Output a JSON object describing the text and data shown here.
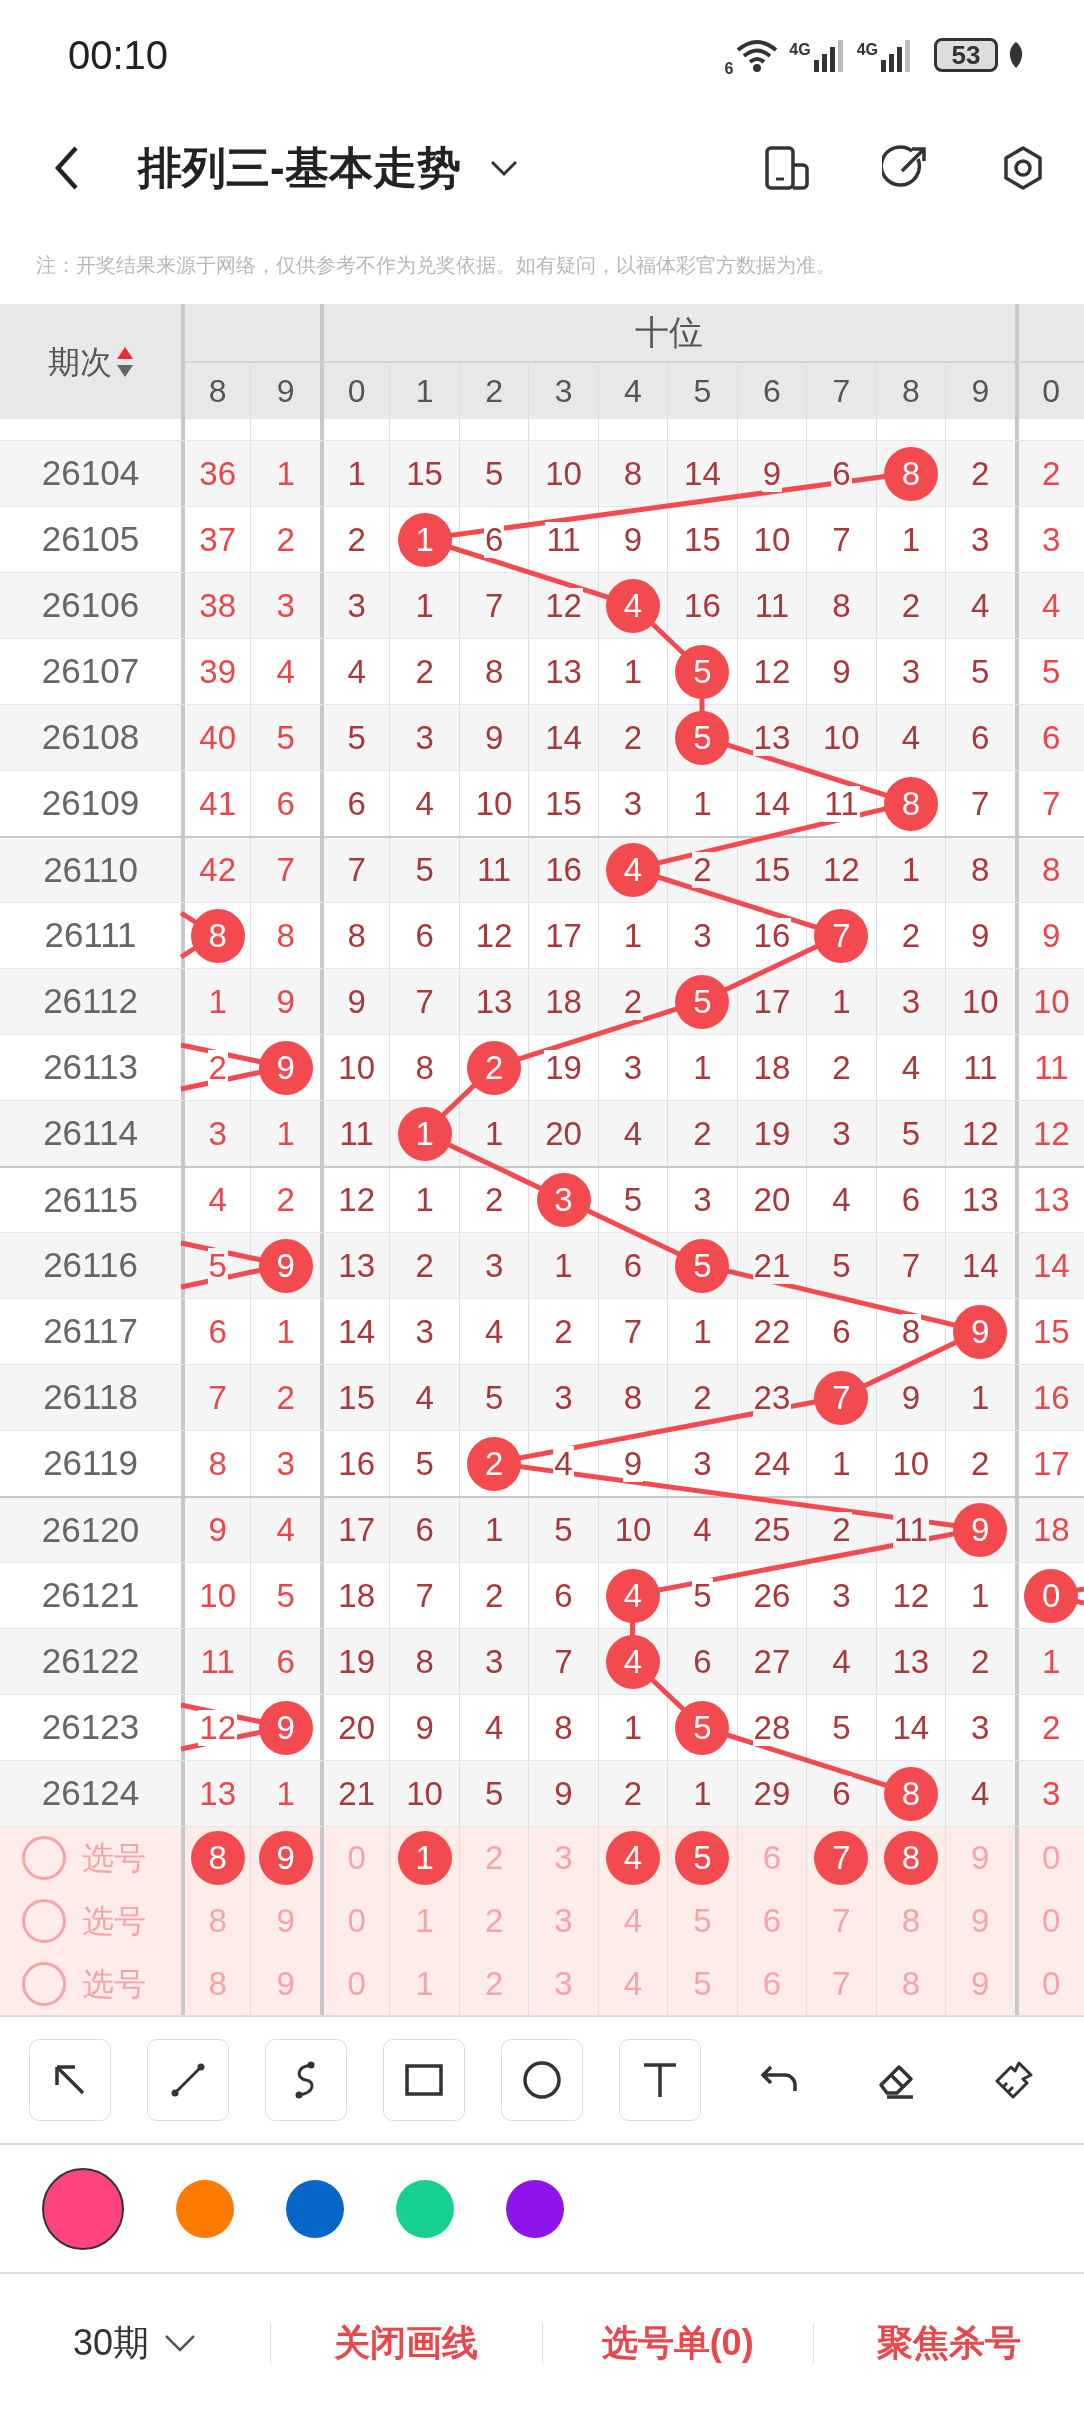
{
  "status_bar": {
    "time": "00:10",
    "wifi_label": "6",
    "signal_labels": [
      "4G",
      "4G"
    ],
    "battery": "53"
  },
  "header": {
    "title": "排列三-基本走势"
  },
  "note": "注：开奖结果来源于网络，仅供参考不作为兑奖依据。如有疑问，以福体彩官方数据为准。",
  "table": {
    "period_header": "期次",
    "group_header": "十位",
    "digit_headers": [
      "8",
      "9",
      "0",
      "1",
      "2",
      "3",
      "4",
      "5",
      "6",
      "7",
      "8",
      "9",
      "0"
    ],
    "rows": [
      {
        "issue": "26104",
        "cells": [
          {
            "text": "36",
            "hit": false
          },
          {
            "text": "1",
            "hit": false
          },
          {
            "text": "1",
            "hit": false
          },
          {
            "text": "15",
            "hit": false
          },
          {
            "text": "5",
            "hit": false
          },
          {
            "text": "10",
            "hit": false
          },
          {
            "text": "8",
            "hit": false
          },
          {
            "text": "14",
            "hit": false
          },
          {
            "text": "9",
            "hit": false
          },
          {
            "text": "6",
            "hit": false
          },
          {
            "text": "8",
            "hit": true
          },
          {
            "text": "2",
            "hit": false
          },
          {
            "text": "2",
            "hit": false
          }
        ]
      },
      {
        "issue": "26105",
        "cells": [
          {
            "text": "37",
            "hit": false
          },
          {
            "text": "2",
            "hit": false
          },
          {
            "text": "2",
            "hit": false
          },
          {
            "text": "1",
            "hit": true
          },
          {
            "text": "6",
            "hit": false
          },
          {
            "text": "11",
            "hit": false
          },
          {
            "text": "9",
            "hit": false
          },
          {
            "text": "15",
            "hit": false
          },
          {
            "text": "10",
            "hit": false
          },
          {
            "text": "7",
            "hit": false
          },
          {
            "text": "1",
            "hit": false
          },
          {
            "text": "3",
            "hit": false
          },
          {
            "text": "3",
            "hit": false
          }
        ]
      },
      {
        "issue": "26106",
        "cells": [
          {
            "text": "38",
            "hit": false
          },
          {
            "text": "3",
            "hit": false
          },
          {
            "text": "3",
            "hit": false
          },
          {
            "text": "1",
            "hit": false
          },
          {
            "text": "7",
            "hit": false
          },
          {
            "text": "12",
            "hit": false
          },
          {
            "text": "4",
            "hit": true
          },
          {
            "text": "16",
            "hit": false
          },
          {
            "text": "11",
            "hit": false
          },
          {
            "text": "8",
            "hit": false
          },
          {
            "text": "2",
            "hit": false
          },
          {
            "text": "4",
            "hit": false
          },
          {
            "text": "4",
            "hit": false
          }
        ]
      },
      {
        "issue": "26107",
        "cells": [
          {
            "text": "39",
            "hit": false
          },
          {
            "text": "4",
            "hit": false
          },
          {
            "text": "4",
            "hit": false
          },
          {
            "text": "2",
            "hit": false
          },
          {
            "text": "8",
            "hit": false
          },
          {
            "text": "13",
            "hit": false
          },
          {
            "text": "1",
            "hit": false
          },
          {
            "text": "5",
            "hit": true
          },
          {
            "text": "12",
            "hit": false
          },
          {
            "text": "9",
            "hit": false
          },
          {
            "text": "3",
            "hit": false
          },
          {
            "text": "5",
            "hit": false
          },
          {
            "text": "5",
            "hit": false
          }
        ]
      },
      {
        "issue": "26108",
        "cells": [
          {
            "text": "40",
            "hit": false
          },
          {
            "text": "5",
            "hit": false
          },
          {
            "text": "5",
            "hit": false
          },
          {
            "text": "3",
            "hit": false
          },
          {
            "text": "9",
            "hit": false
          },
          {
            "text": "14",
            "hit": false
          },
          {
            "text": "2",
            "hit": false
          },
          {
            "text": "5",
            "hit": true
          },
          {
            "text": "13",
            "hit": false
          },
          {
            "text": "10",
            "hit": false
          },
          {
            "text": "4",
            "hit": false
          },
          {
            "text": "6",
            "hit": false
          },
          {
            "text": "6",
            "hit": false
          }
        ]
      },
      {
        "issue": "26109",
        "cells": [
          {
            "text": "41",
            "hit": false
          },
          {
            "text": "6",
            "hit": false
          },
          {
            "text": "6",
            "hit": false
          },
          {
            "text": "4",
            "hit": false
          },
          {
            "text": "10",
            "hit": false
          },
          {
            "text": "15",
            "hit": false
          },
          {
            "text": "3",
            "hit": false
          },
          {
            "text": "1",
            "hit": false
          },
          {
            "text": "14",
            "hit": false
          },
          {
            "text": "11",
            "hit": false
          },
          {
            "text": "8",
            "hit": true
          },
          {
            "text": "7",
            "hit": false
          },
          {
            "text": "7",
            "hit": false
          }
        ]
      },
      {
        "issue": "26110",
        "cells": [
          {
            "text": "42",
            "hit": false
          },
          {
            "text": "7",
            "hit": false
          },
          {
            "text": "7",
            "hit": false
          },
          {
            "text": "5",
            "hit": false
          },
          {
            "text": "11",
            "hit": false
          },
          {
            "text": "16",
            "hit": false
          },
          {
            "text": "4",
            "hit": true
          },
          {
            "text": "2",
            "hit": false
          },
          {
            "text": "15",
            "hit": false
          },
          {
            "text": "12",
            "hit": false
          },
          {
            "text": "1",
            "hit": false
          },
          {
            "text": "8",
            "hit": false
          },
          {
            "text": "8",
            "hit": false
          }
        ]
      },
      {
        "issue": "26111",
        "cells": [
          {
            "text": "8",
            "hit": true
          },
          {
            "text": "8",
            "hit": false
          },
          {
            "text": "8",
            "hit": false
          },
          {
            "text": "6",
            "hit": false
          },
          {
            "text": "12",
            "hit": false
          },
          {
            "text": "17",
            "hit": false
          },
          {
            "text": "1",
            "hit": false
          },
          {
            "text": "3",
            "hit": false
          },
          {
            "text": "16",
            "hit": false
          },
          {
            "text": "7",
            "hit": true
          },
          {
            "text": "2",
            "hit": false
          },
          {
            "text": "9",
            "hit": false
          },
          {
            "text": "9",
            "hit": false
          }
        ]
      },
      {
        "issue": "26112",
        "cells": [
          {
            "text": "1",
            "hit": false
          },
          {
            "text": "9",
            "hit": false
          },
          {
            "text": "9",
            "hit": false
          },
          {
            "text": "7",
            "hit": false
          },
          {
            "text": "13",
            "hit": false
          },
          {
            "text": "18",
            "hit": false
          },
          {
            "text": "2",
            "hit": false
          },
          {
            "text": "5",
            "hit": true
          },
          {
            "text": "17",
            "hit": false
          },
          {
            "text": "1",
            "hit": false
          },
          {
            "text": "3",
            "hit": false
          },
          {
            "text": "10",
            "hit": false
          },
          {
            "text": "10",
            "hit": false
          }
        ]
      },
      {
        "issue": "26113",
        "cells": [
          {
            "text": "2",
            "hit": false
          },
          {
            "text": "9",
            "hit": true
          },
          {
            "text": "10",
            "hit": false
          },
          {
            "text": "8",
            "hit": false
          },
          {
            "text": "2",
            "hit": true
          },
          {
            "text": "19",
            "hit": false
          },
          {
            "text": "3",
            "hit": false
          },
          {
            "text": "1",
            "hit": false
          },
          {
            "text": "18",
            "hit": false
          },
          {
            "text": "2",
            "hit": false
          },
          {
            "text": "4",
            "hit": false
          },
          {
            "text": "11",
            "hit": false
          },
          {
            "text": "11",
            "hit": false
          }
        ]
      },
      {
        "issue": "26114",
        "cells": [
          {
            "text": "3",
            "hit": false
          },
          {
            "text": "1",
            "hit": false
          },
          {
            "text": "11",
            "hit": false
          },
          {
            "text": "1",
            "hit": true
          },
          {
            "text": "1",
            "hit": false
          },
          {
            "text": "20",
            "hit": false
          },
          {
            "text": "4",
            "hit": false
          },
          {
            "text": "2",
            "hit": false
          },
          {
            "text": "19",
            "hit": false
          },
          {
            "text": "3",
            "hit": false
          },
          {
            "text": "5",
            "hit": false
          },
          {
            "text": "12",
            "hit": false
          },
          {
            "text": "12",
            "hit": false
          }
        ]
      },
      {
        "issue": "26115",
        "cells": [
          {
            "text": "4",
            "hit": false
          },
          {
            "text": "2",
            "hit": false
          },
          {
            "text": "12",
            "hit": false
          },
          {
            "text": "1",
            "hit": false
          },
          {
            "text": "2",
            "hit": false
          },
          {
            "text": "3",
            "hit": true
          },
          {
            "text": "5",
            "hit": false
          },
          {
            "text": "3",
            "hit": false
          },
          {
            "text": "20",
            "hit": false
          },
          {
            "text": "4",
            "hit": false
          },
          {
            "text": "6",
            "hit": false
          },
          {
            "text": "13",
            "hit": false
          },
          {
            "text": "13",
            "hit": false
          }
        ]
      },
      {
        "issue": "26116",
        "cells": [
          {
            "text": "5",
            "hit": false
          },
          {
            "text": "9",
            "hit": true
          },
          {
            "text": "13",
            "hit": false
          },
          {
            "text": "2",
            "hit": false
          },
          {
            "text": "3",
            "hit": false
          },
          {
            "text": "1",
            "hit": false
          },
          {
            "text": "6",
            "hit": false
          },
          {
            "text": "5",
            "hit": true
          },
          {
            "text": "21",
            "hit": false
          },
          {
            "text": "5",
            "hit": false
          },
          {
            "text": "7",
            "hit": false
          },
          {
            "text": "14",
            "hit": false
          },
          {
            "text": "14",
            "hit": false
          }
        ]
      },
      {
        "issue": "26117",
        "cells": [
          {
            "text": "6",
            "hit": false
          },
          {
            "text": "1",
            "hit": false
          },
          {
            "text": "14",
            "hit": false
          },
          {
            "text": "3",
            "hit": false
          },
          {
            "text": "4",
            "hit": false
          },
          {
            "text": "2",
            "hit": false
          },
          {
            "text": "7",
            "hit": false
          },
          {
            "text": "1",
            "hit": false
          },
          {
            "text": "22",
            "hit": false
          },
          {
            "text": "6",
            "hit": false
          },
          {
            "text": "8",
            "hit": false
          },
          {
            "text": "9",
            "hit": true
          },
          {
            "text": "15",
            "hit": false
          }
        ]
      },
      {
        "issue": "26118",
        "cells": [
          {
            "text": "7",
            "hit": false
          },
          {
            "text": "2",
            "hit": false
          },
          {
            "text": "15",
            "hit": false
          },
          {
            "text": "4",
            "hit": false
          },
          {
            "text": "5",
            "hit": false
          },
          {
            "text": "3",
            "hit": false
          },
          {
            "text": "8",
            "hit": false
          },
          {
            "text": "2",
            "hit": false
          },
          {
            "text": "23",
            "hit": false
          },
          {
            "text": "7",
            "hit": true
          },
          {
            "text": "9",
            "hit": false
          },
          {
            "text": "1",
            "hit": false
          },
          {
            "text": "16",
            "hit": false
          }
        ]
      },
      {
        "issue": "26119",
        "cells": [
          {
            "text": "8",
            "hit": false
          },
          {
            "text": "3",
            "hit": false
          },
          {
            "text": "16",
            "hit": false
          },
          {
            "text": "5",
            "hit": false
          },
          {
            "text": "2",
            "hit": true
          },
          {
            "text": "4",
            "hit": false
          },
          {
            "text": "9",
            "hit": false
          },
          {
            "text": "3",
            "hit": false
          },
          {
            "text": "24",
            "hit": false
          },
          {
            "text": "1",
            "hit": false
          },
          {
            "text": "10",
            "hit": false
          },
          {
            "text": "2",
            "hit": false
          },
          {
            "text": "17",
            "hit": false
          }
        ]
      },
      {
        "issue": "26120",
        "cells": [
          {
            "text": "9",
            "hit": false
          },
          {
            "text": "4",
            "hit": false
          },
          {
            "text": "17",
            "hit": false
          },
          {
            "text": "6",
            "hit": false
          },
          {
            "text": "1",
            "hit": false
          },
          {
            "text": "5",
            "hit": false
          },
          {
            "text": "10",
            "hit": false
          },
          {
            "text": "4",
            "hit": false
          },
          {
            "text": "25",
            "hit": false
          },
          {
            "text": "2",
            "hit": false
          },
          {
            "text": "11",
            "hit": false
          },
          {
            "text": "9",
            "hit": true
          },
          {
            "text": "18",
            "hit": false
          }
        ]
      },
      {
        "issue": "26121",
        "cells": [
          {
            "text": "10",
            "hit": false
          },
          {
            "text": "5",
            "hit": false
          },
          {
            "text": "18",
            "hit": false
          },
          {
            "text": "7",
            "hit": false
          },
          {
            "text": "2",
            "hit": false
          },
          {
            "text": "6",
            "hit": false
          },
          {
            "text": "4",
            "hit": true
          },
          {
            "text": "5",
            "hit": false
          },
          {
            "text": "26",
            "hit": false
          },
          {
            "text": "3",
            "hit": false
          },
          {
            "text": "12",
            "hit": false
          },
          {
            "text": "1",
            "hit": false
          },
          {
            "text": "0",
            "hit": true
          }
        ]
      },
      {
        "issue": "26122",
        "cells": [
          {
            "text": "11",
            "hit": false
          },
          {
            "text": "6",
            "hit": false
          },
          {
            "text": "19",
            "hit": false
          },
          {
            "text": "8",
            "hit": false
          },
          {
            "text": "3",
            "hit": false
          },
          {
            "text": "7",
            "hit": false
          },
          {
            "text": "4",
            "hit": true
          },
          {
            "text": "6",
            "hit": false
          },
          {
            "text": "27",
            "hit": false
          },
          {
            "text": "4",
            "hit": false
          },
          {
            "text": "13",
            "hit": false
          },
          {
            "text": "2",
            "hit": false
          },
          {
            "text": "1",
            "hit": false
          }
        ]
      },
      {
        "issue": "26123",
        "cells": [
          {
            "text": "12",
            "hit": false
          },
          {
            "text": "9",
            "hit": true
          },
          {
            "text": "20",
            "hit": false
          },
          {
            "text": "9",
            "hit": false
          },
          {
            "text": "4",
            "hit": false
          },
          {
            "text": "8",
            "hit": false
          },
          {
            "text": "1",
            "hit": false
          },
          {
            "text": "5",
            "hit": true
          },
          {
            "text": "28",
            "hit": false
          },
          {
            "text": "5",
            "hit": false
          },
          {
            "text": "14",
            "hit": false
          },
          {
            "text": "3",
            "hit": false
          },
          {
            "text": "2",
            "hit": false
          }
        ]
      },
      {
        "issue": "26124",
        "cells": [
          {
            "text": "13",
            "hit": false
          },
          {
            "text": "1",
            "hit": false
          },
          {
            "text": "21",
            "hit": false
          },
          {
            "text": "10",
            "hit": false
          },
          {
            "text": "5",
            "hit": false
          },
          {
            "text": "9",
            "hit": false
          },
          {
            "text": "2",
            "hit": false
          },
          {
            "text": "1",
            "hit": false
          },
          {
            "text": "29",
            "hit": false
          },
          {
            "text": "6",
            "hit": false
          },
          {
            "text": "8",
            "hit": true
          },
          {
            "text": "4",
            "hit": false
          },
          {
            "text": "3",
            "hit": false
          }
        ]
      }
    ],
    "pick_rows": [
      {
        "label": "选号",
        "checked": false,
        "numbers": [
          {
            "text": "8",
            "selected": true
          },
          {
            "text": "9",
            "selected": true
          },
          {
            "text": "0",
            "selected": false
          },
          {
            "text": "1",
            "selected": true
          },
          {
            "text": "2",
            "selected": false
          },
          {
            "text": "3",
            "selected": false
          },
          {
            "text": "4",
            "selected": true
          },
          {
            "text": "5",
            "selected": true
          },
          {
            "text": "6",
            "selected": false
          },
          {
            "text": "7",
            "selected": true
          },
          {
            "text": "8",
            "selected": true
          },
          {
            "text": "9",
            "selected": false
          },
          {
            "text": "0",
            "selected": false
          }
        ]
      },
      {
        "label": "选号",
        "checked": false,
        "numbers": [
          {
            "text": "8",
            "selected": false
          },
          {
            "text": "9",
            "selected": false
          },
          {
            "text": "0",
            "selected": false
          },
          {
            "text": "1",
            "selected": false
          },
          {
            "text": "2",
            "selected": false
          },
          {
            "text": "3",
            "selected": false
          },
          {
            "text": "4",
            "selected": false
          },
          {
            "text": "5",
            "selected": false
          },
          {
            "text": "6",
            "selected": false
          },
          {
            "text": "7",
            "selected": false
          },
          {
            "text": "8",
            "selected": false
          },
          {
            "text": "9",
            "selected": false
          },
          {
            "text": "0",
            "selected": false
          }
        ]
      },
      {
        "label": "选号",
        "checked": false,
        "numbers": [
          {
            "text": "8",
            "selected": false
          },
          {
            "text": "9",
            "selected": false
          },
          {
            "text": "0",
            "selected": false
          },
          {
            "text": "1",
            "selected": false
          },
          {
            "text": "2",
            "selected": false
          },
          {
            "text": "3",
            "selected": false
          },
          {
            "text": "4",
            "selected": false
          },
          {
            "text": "5",
            "selected": false
          },
          {
            "text": "6",
            "selected": false
          },
          {
            "text": "7",
            "selected": false
          },
          {
            "text": "8",
            "selected": false
          },
          {
            "text": "9",
            "selected": false
          },
          {
            "text": "0",
            "selected": false
          }
        ]
      }
    ]
  },
  "draw_tools": [
    {
      "kind": "arrow",
      "boxed": true
    },
    {
      "kind": "line",
      "boxed": true
    },
    {
      "kind": "curve",
      "boxed": true
    },
    {
      "kind": "rectangle",
      "boxed": true
    },
    {
      "kind": "circle",
      "boxed": true
    },
    {
      "kind": "text",
      "boxed": true
    },
    {
      "kind": "undo",
      "boxed": false
    },
    {
      "kind": "eraser",
      "boxed": false
    },
    {
      "kind": "brush",
      "boxed": false
    }
  ],
  "pen_colors": [
    {
      "color": "#ff4480",
      "selected": true
    },
    {
      "color": "#ff7a00",
      "selected": false
    },
    {
      "color": "#0767c8",
      "selected": false
    },
    {
      "color": "#16d090",
      "selected": false
    },
    {
      "color": "#9013ea",
      "selected": false
    }
  ],
  "bottom_bar": [
    {
      "label": "30期",
      "kind": "dropdown"
    },
    {
      "label": "关闭画线",
      "kind": "action"
    },
    {
      "label": "选号单(0)",
      "kind": "action"
    },
    {
      "label": "聚焦杀号",
      "kind": "action"
    }
  ]
}
